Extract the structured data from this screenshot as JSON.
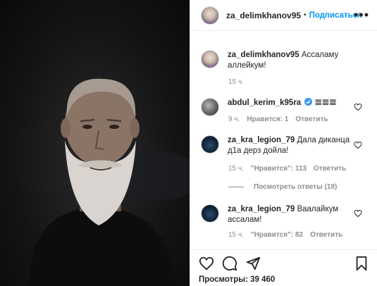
{
  "post": {
    "author": "za_delimkhanov95",
    "separator": "•",
    "follow_label": "Подписаться",
    "more_label": "•••"
  },
  "comments": [
    {
      "username": "za_delimkhanov95",
      "text": "Ассаламу аллейкум!",
      "time": "15 ч.",
      "avatar": "author-avatar"
    },
    {
      "username": "abdul_kerim_k95ra",
      "verified": true,
      "text": "𝌆𝌆𝌆",
      "time": "9 ч.",
      "likes": "Нравится: 1",
      "reply": "Ответить",
      "avatar": "user-avatar"
    },
    {
      "username": "za_kra_legion_79",
      "text": "Дала диканца д1а дерз дойла!",
      "time": "15 ч.",
      "likes": "\"Нравится\": 113",
      "reply": "Ответить",
      "view_replies": "Посмотреть ответы (18)",
      "avatar": "user-avatar"
    },
    {
      "username": "za_kra_legion_79",
      "text": "Ваалайкум ассалам!",
      "time": "15 ч.",
      "likes": "\"Нравится\": 82",
      "reply": "Ответить",
      "avatar": "user-avatar"
    }
  ],
  "actions": {
    "like_icon": "heart-icon",
    "comment_icon": "comment-icon",
    "share_icon": "share-icon",
    "save_icon": "bookmark-icon",
    "views_label": "Просмотры: 39 460"
  },
  "colors": {
    "accent": "#0095f6",
    "muted": "#8e8e8e",
    "text": "#262626",
    "verified": "#3897f0"
  }
}
